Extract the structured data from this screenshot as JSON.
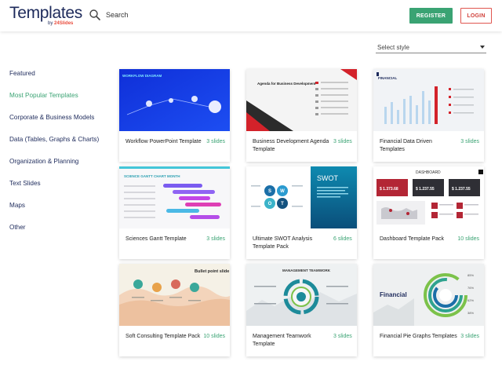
{
  "header": {
    "logo": "Templates",
    "logo_sub_prefix": "by ",
    "logo_sub_brand": "24Slides",
    "search_label": "Search",
    "register_label": "REGISTER",
    "login_label": "LOGIN"
  },
  "style_select": {
    "value": "Select style"
  },
  "sidebar": {
    "items": [
      {
        "label": "Featured"
      },
      {
        "label": "Most Popular Templates"
      },
      {
        "label": "Corporate & Business Models"
      },
      {
        "label": "Data (Tables, Graphs & Charts)"
      },
      {
        "label": "Organization & Planning"
      },
      {
        "label": "Text Slides"
      },
      {
        "label": "Maps"
      },
      {
        "label": "Other"
      }
    ],
    "active_index": 1
  },
  "cards": [
    {
      "title": "Workflow PowerPoint Template",
      "count": "3 slides",
      "thumb_text": "WORKFLOW DIAGRAM"
    },
    {
      "title": "Business Development Agenda Template",
      "count": "3 slides",
      "thumb_text": "Agenda for Business Development"
    },
    {
      "title": "Financial Data Driven Templates",
      "count": "3 slides",
      "thumb_text": "FINANCIAL"
    },
    {
      "title": "Sciences Gantt Template",
      "count": "3 slides",
      "thumb_text": "SCIENCE GANTT CHART MONTH"
    },
    {
      "title": "Ultimate SWOT Analysis Template Pack",
      "count": "6 slides",
      "thumb_text": "SWOT"
    },
    {
      "title": "Dashboard Template Pack",
      "count": "10 slides",
      "thumb_text": "DASHBOARD",
      "thumb_values": [
        "$ 1.373.68",
        "$ 1.237.55",
        "$ 1.237.55"
      ]
    },
    {
      "title": "Soft Consulting Template Pack",
      "count": "10 slides",
      "thumb_text": "Bullet point slide"
    },
    {
      "title": "Management Teamwork Template",
      "count": "3 slides",
      "thumb_text": "MANAGEMENT TEAMWORK"
    },
    {
      "title": "Financial Pie Graphs Templates",
      "count": "3 slides",
      "thumb_text": "Financial",
      "thumb_values": [
        "85%",
        "76%",
        "62%",
        "38%"
      ]
    }
  ],
  "colors": {
    "brand": "#1d2a5b",
    "accent_green": "#3aa373",
    "login_red": "#e0564f"
  }
}
